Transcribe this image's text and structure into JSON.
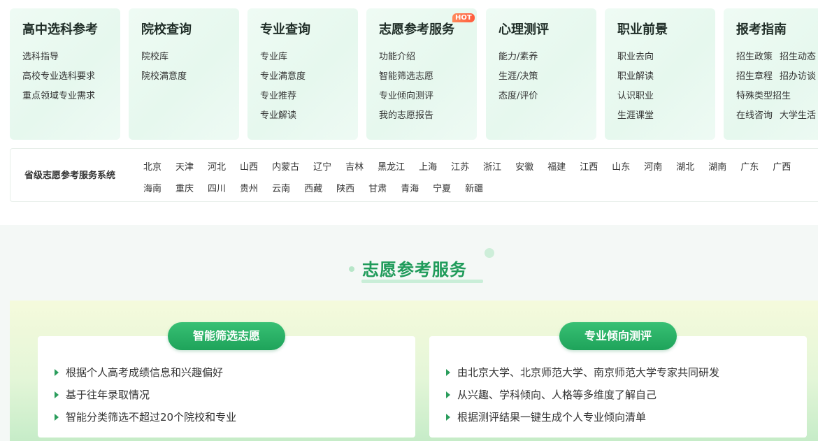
{
  "cards": [
    {
      "title": "高中选科参考",
      "items": [
        "选科指导",
        "高校专业选科要求",
        "重点领域专业需求"
      ]
    },
    {
      "title": "院校查询",
      "items": [
        "院校库",
        "院校满意度"
      ]
    },
    {
      "title": "专业查询",
      "items": [
        "专业库",
        "专业满意度",
        "专业推荐",
        "专业解读"
      ]
    },
    {
      "title": "志愿参考服务",
      "badge": "HOT",
      "items": [
        "功能介绍",
        "智能筛选志愿",
        "专业倾向测评",
        "我的志愿报告"
      ]
    },
    {
      "title": "心理测评",
      "items": [
        "能力/素养",
        "生涯/决策",
        "态度/评价"
      ]
    },
    {
      "title": "职业前景",
      "items": [
        "职业去向",
        "职业解读",
        "认识职业",
        "生涯课堂"
      ]
    },
    {
      "title": "报考指南",
      "rows": [
        [
          "招生政策",
          "招生动态"
        ],
        [
          "招生章程",
          "招办访谈"
        ],
        [
          "特殊类型招生"
        ],
        [
          "在线咨询",
          "大学生活"
        ]
      ]
    }
  ],
  "provinces": {
    "label": "省级志愿参考服务系统",
    "row1": [
      "北京",
      "天津",
      "河北",
      "山西",
      "内蒙古",
      "辽宁",
      "吉林",
      "黑龙江",
      "上海",
      "江苏",
      "浙江",
      "安徽",
      "福建",
      "江西",
      "山东",
      "河南",
      "湖北",
      "湖南",
      "广东",
      "广西"
    ],
    "row2": [
      "海南",
      "重庆",
      "四川",
      "贵州",
      "云南",
      "西藏",
      "陕西",
      "甘肃",
      "青海",
      "宁夏",
      "新疆"
    ]
  },
  "section": {
    "title": "志愿参考服务",
    "left": {
      "pill": "智能筛选志愿",
      "lines": [
        "根据个人高考成绩信息和兴趣偏好",
        "基于往年录取情况",
        "智能分类筛选不超过20个院校和专业"
      ]
    },
    "right": {
      "pill": "专业倾向测评",
      "lines": [
        "由北京大学、北京师范大学、南京师范大学专家共同研发",
        "从兴趣、学科倾向、人格等多维度了解自己",
        "根据测评结果一键生成个人专业倾向清单"
      ]
    }
  }
}
